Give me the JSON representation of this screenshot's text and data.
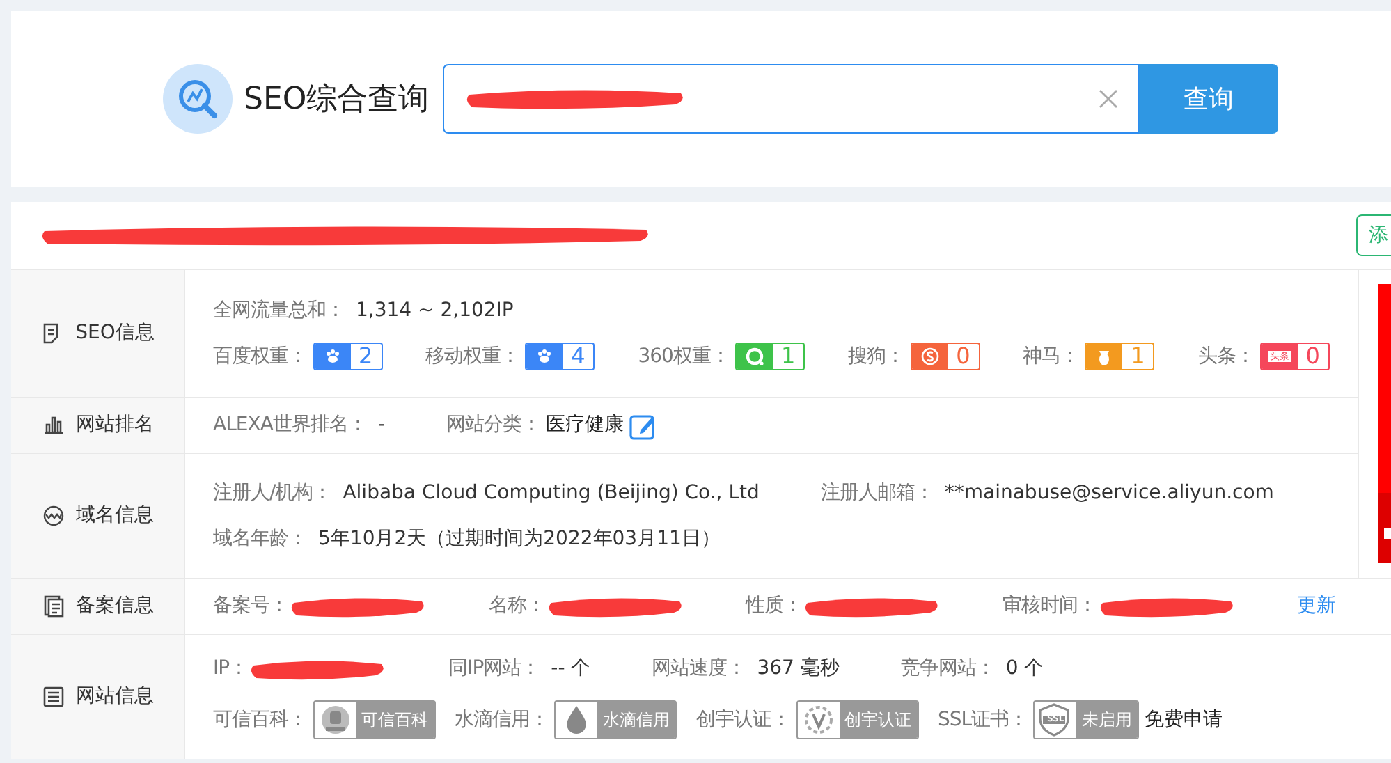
{
  "search": {
    "title": "SEO综合查询",
    "button": "查询"
  },
  "header": {
    "action": "添"
  },
  "sections": [
    {
      "label": "SEO信息",
      "lines": [
        [
          {
            "kind": "text",
            "label": "全网流量总和：",
            "value": "1,314 ~ 2,102IP"
          }
        ],
        [
          {
            "kind": "weight",
            "label": "百度权重：",
            "value": "2",
            "color": "#3b86f7"
          },
          {
            "kind": "weight",
            "label": "移动权重：",
            "value": "4",
            "color": "#3b86f7"
          },
          {
            "kind": "weight",
            "label": "360权重：",
            "value": "1",
            "color": "#3ec34a"
          },
          {
            "kind": "weight",
            "label": "搜狗：",
            "value": "0",
            "color": "#f5643c"
          },
          {
            "kind": "weight",
            "label": "神马：",
            "value": "1",
            "color": "#f39a1f"
          },
          {
            "kind": "weight",
            "label": "头条：",
            "value": "0",
            "color": "#f5475b",
            "icon_text": "头条"
          }
        ]
      ]
    },
    {
      "label": "网站排名",
      "lines": [
        [
          {
            "kind": "text",
            "label": "ALEXA世界排名：",
            "value": "-"
          },
          {
            "kind": "edit",
            "label": "网站分类：",
            "value": "医疗健康"
          }
        ]
      ]
    },
    {
      "label": "域名信息",
      "lines": [
        [
          {
            "kind": "text",
            "label": "注册人/机构：",
            "value": "Alibaba Cloud Computing (Beijing) Co., Ltd"
          },
          {
            "kind": "text",
            "label": "注册人邮箱：",
            "value": "**mainabuse@service.aliyun.com"
          }
        ],
        [
          {
            "kind": "text",
            "label": "域名年龄：",
            "value": "5年10月2天（过期时间为2022年03月11日）"
          }
        ]
      ]
    },
    {
      "label": "备案信息",
      "lines": [
        [
          {
            "kind": "redacted",
            "label": "备案号："
          },
          {
            "kind": "redacted",
            "label": "名称："
          },
          {
            "kind": "redacted",
            "label": "性质："
          },
          {
            "kind": "redacted",
            "label": "审核时间："
          },
          {
            "kind": "link",
            "value": "更新"
          }
        ]
      ]
    },
    {
      "label": "网站信息",
      "lines": [
        [
          {
            "kind": "redacted",
            "label": "IP："
          },
          {
            "kind": "text",
            "label": "同IP网站：",
            "value": "-- 个"
          },
          {
            "kind": "text",
            "label": "网站速度：",
            "value": "367 毫秒"
          },
          {
            "kind": "text",
            "label": "竞争网站：",
            "value": "0 个"
          }
        ],
        [
          {
            "kind": "cert",
            "label": "可信百科：",
            "value": "可信百科"
          },
          {
            "kind": "cert",
            "label": "水滴信用：",
            "value": "水滴信用"
          },
          {
            "kind": "cert",
            "label": "创宇认证：",
            "value": "创宇认证"
          },
          {
            "kind": "cert",
            "label": "SSL证书：",
            "value": "未启用",
            "icon_text": "SSL",
            "extra": "免费申请"
          }
        ]
      ]
    }
  ]
}
